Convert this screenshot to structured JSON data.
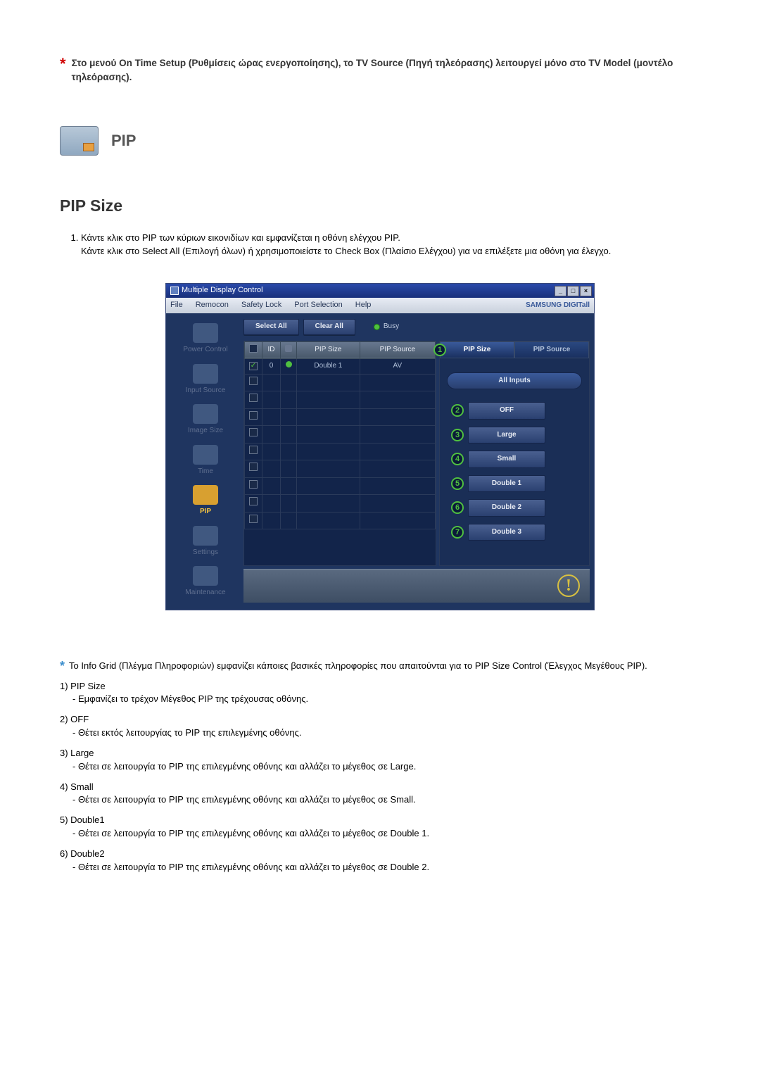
{
  "top_note": "Στο μενού On Time Setup (Ρυθμίσεις ώρας ενεργοποίησης), το TV Source (Πηγή τηλεόρασης) λειτουργεί μόνο στο TV Model (μοντέλο τηλεόρασης).",
  "section_title": "PIP",
  "section_subtitle": "PIP Size",
  "intro_list": [
    "Κάντε κλικ στο PIP των κύριων εικονιδίων και εμφανίζεται η οθόνη ελέγχου PIP.\nΚάντε κλικ στο Select All (Επιλογή όλων) ή χρησιμοποιείστε το Check Box (Πλαίσιο Ελέγχου) για να επιλέξετε μια οθόνη για έλεγχο."
  ],
  "app": {
    "title": "Multiple Display Control",
    "menu": [
      "File",
      "Remocon",
      "Safety Lock",
      "Port Selection",
      "Help"
    ],
    "brand": "SAMSUNG DIGITall",
    "sidebar": [
      {
        "label": "Power Control",
        "active": false
      },
      {
        "label": "Input Source",
        "active": false
      },
      {
        "label": "Image Size",
        "active": false
      },
      {
        "label": "Time",
        "active": false
      },
      {
        "label": "PIP",
        "active": true
      },
      {
        "label": "Settings",
        "active": false
      },
      {
        "label": "Maintenance",
        "active": false
      }
    ],
    "toolbar": {
      "select_all": "Select All",
      "clear_all": "Clear All",
      "busy": "Busy"
    },
    "grid": {
      "headers": [
        "",
        "ID",
        "",
        "PIP Size",
        "PIP Source"
      ],
      "rows": [
        {
          "chk": true,
          "id": "0",
          "status": "g",
          "size": "Double 1",
          "src": "AV"
        },
        {
          "chk": false,
          "id": "",
          "status": "",
          "size": "",
          "src": ""
        },
        {
          "chk": false,
          "id": "",
          "status": "",
          "size": "",
          "src": ""
        },
        {
          "chk": false,
          "id": "",
          "status": "",
          "size": "",
          "src": ""
        },
        {
          "chk": false,
          "id": "",
          "status": "",
          "size": "",
          "src": ""
        },
        {
          "chk": false,
          "id": "",
          "status": "",
          "size": "",
          "src": ""
        },
        {
          "chk": false,
          "id": "",
          "status": "",
          "size": "",
          "src": ""
        },
        {
          "chk": false,
          "id": "",
          "status": "",
          "size": "",
          "src": ""
        },
        {
          "chk": false,
          "id": "",
          "status": "",
          "size": "",
          "src": ""
        },
        {
          "chk": false,
          "id": "",
          "status": "",
          "size": "",
          "src": ""
        }
      ]
    },
    "right": {
      "tab_size": "PIP Size",
      "tab_source": "PIP Source",
      "all_inputs": "All Inputs",
      "buttons": [
        {
          "n": "2",
          "label": "OFF"
        },
        {
          "n": "3",
          "label": "Large"
        },
        {
          "n": "4",
          "label": "Small"
        },
        {
          "n": "5",
          "label": "Double 1"
        },
        {
          "n": "6",
          "label": "Double 2"
        },
        {
          "n": "7",
          "label": "Double 3"
        }
      ]
    }
  },
  "info_grid_note": "Το Info Grid (Πλέγμα Πληροφοριών) εμφανίζει κάποιες βασικές πληροφορίες που απαιτούνται για το PIP Size Control (Έλεγχος Μεγέθους PIP).",
  "definitions": [
    {
      "num": "1)",
      "term": "PIP Size",
      "desc": "- Εμφανίζει το τρέχον Μέγεθος PIP της τρέχουσας οθόνης."
    },
    {
      "num": "2)",
      "term": "OFF",
      "desc": "- Θέτει εκτός λειτουργίας το PIP της επιλεγμένης οθόνης."
    },
    {
      "num": "3)",
      "term": "Large",
      "desc": "- Θέτει σε λειτουργία το PIP της επιλεγμένης οθόνης και αλλάζει το μέγεθος σε Large."
    },
    {
      "num": "4)",
      "term": "Small",
      "desc": "- Θέτει σε λειτουργία το PIP της επιλεγμένης οθόνης και αλλάζει το μέγεθος σε Small."
    },
    {
      "num": "5)",
      "term": "Double1",
      "desc": "- Θέτει σε λειτουργία το PIP της επιλεγμένης οθόνης και αλλάζει το μέγεθος σε Double 1."
    },
    {
      "num": "6)",
      "term": "Double2",
      "desc": "- Θέτει σε λειτουργία το PIP της επιλεγμένης οθόνης και αλλάζει το μέγεθος σε Double 2."
    }
  ]
}
